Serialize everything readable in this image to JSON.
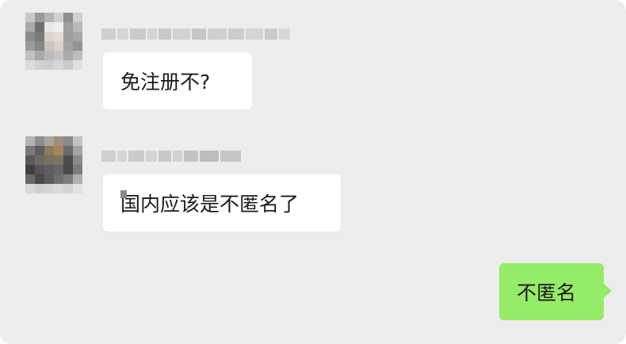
{
  "colors": {
    "chat_background": "#ededed",
    "incoming_bubble": "#ffffff",
    "outgoing_bubble": "#95ec69",
    "text": "#1a1a1a"
  },
  "messages": [
    {
      "direction": "incoming",
      "sender_name_visible": false,
      "text": "免注册不?"
    },
    {
      "direction": "incoming",
      "sender_name_visible": false,
      "text": "国内应该是不匿名了"
    },
    {
      "direction": "outgoing",
      "text": "不匿名"
    }
  ]
}
